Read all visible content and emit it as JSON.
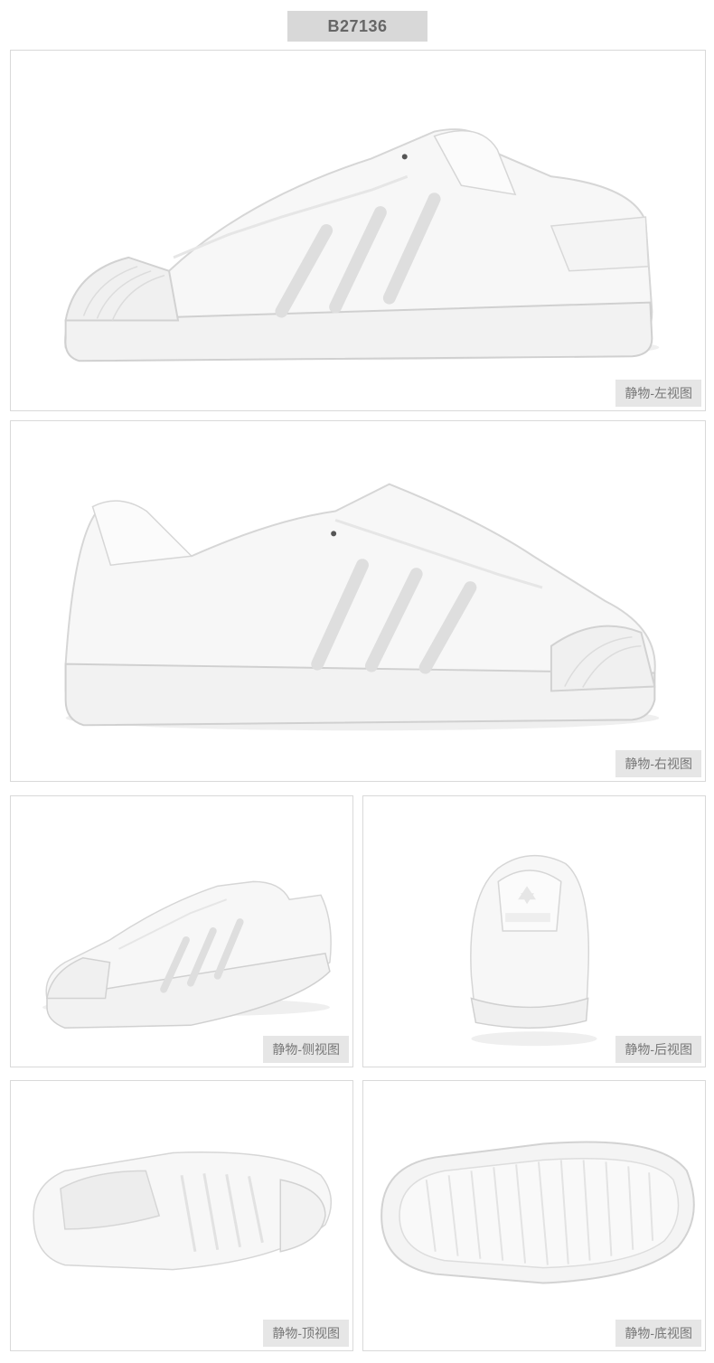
{
  "product": {
    "code": "B27136"
  },
  "views": {
    "left": {
      "label": "静物-左视图"
    },
    "right": {
      "label": "静物-右视图"
    },
    "side": {
      "label": "静物-侧视图"
    },
    "back": {
      "label": "静物-后视图"
    },
    "top": {
      "label": "静物-顶视图"
    },
    "bottom": {
      "label": "静物-底视图"
    }
  },
  "colors": {
    "shoe_upper": "#f7f7f7",
    "shoe_shadow": "#e4e4e4",
    "outline": "#d0d0d0",
    "label_bg": "#e6e6e6",
    "badge_bg": "#d8d8d8"
  }
}
